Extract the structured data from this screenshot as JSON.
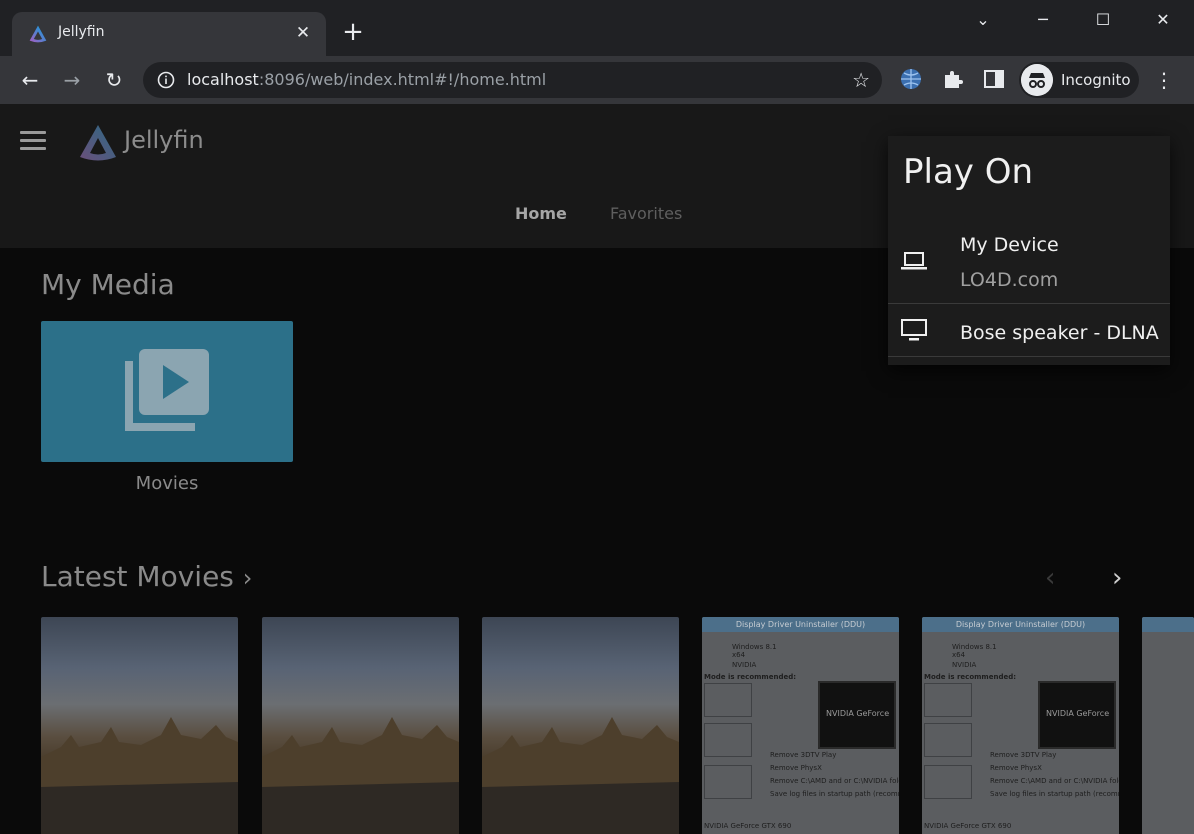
{
  "browser": {
    "tab_title": "Jellyfin",
    "close_tab": "✕",
    "new_tab": "+",
    "url_host": "localhost",
    "url_rest": ":8096/web/index.html#!/home.html",
    "profile_label": "Incognito",
    "window_controls": {
      "minimize": "─",
      "maximize": "☐",
      "close": "✕",
      "tab_search": "⌄"
    }
  },
  "app": {
    "brand": "Jellyfin",
    "tabs": [
      {
        "label": "Home",
        "active": true
      },
      {
        "label": "Favorites",
        "active": false
      }
    ]
  },
  "my_media": {
    "title": "My Media",
    "libraries": [
      {
        "label": "Movies",
        "color": "#2c7089"
      }
    ]
  },
  "latest_movies": {
    "title": "Latest Movies",
    "chevron": "›",
    "prev_arrow": "‹",
    "next_arrow": "›",
    "ddu_title": "Display Driver Uninstaller (DDU)",
    "ddu_lines": [
      "Windows 8.1",
      "x64",
      "NVIDIA",
      "Mode is recommended:",
      "Remove 3DTV Play",
      "Remove PhysX",
      "Remove C:\\AMD and or C:\\NVIDIA folders",
      "Save log files in startup path (recommended)",
      "NVIDIA GeForce GTX 690"
    ],
    "ddu_logo_text": "NVIDIA GeForce"
  },
  "play_on": {
    "title": "Play On",
    "devices": [
      {
        "name": "My Device",
        "subtitle": "LO4D.com",
        "icon": "laptop-icon"
      },
      {
        "name": "Bose speaker - DLNA",
        "subtitle": "",
        "icon": "tv-icon"
      }
    ]
  },
  "colors": {
    "accent_library": "#2c7089",
    "jellyfin_gradient_start": "#aa5cc3",
    "jellyfin_gradient_end": "#00a4dc"
  }
}
